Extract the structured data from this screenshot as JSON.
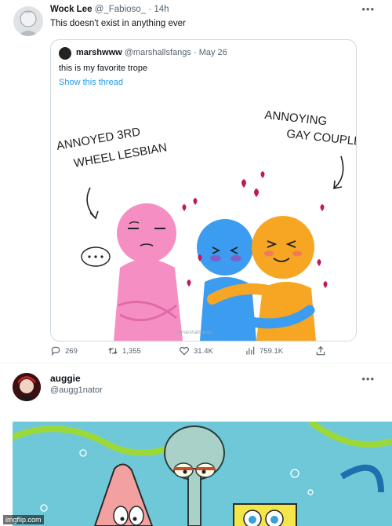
{
  "tweet1": {
    "author_name": "Wock Lee",
    "author_handle": "@_Fabioso_",
    "separator": "·",
    "time": "14h",
    "text": "This doesn't exist in anything ever",
    "more_icon": "more-dots-icon",
    "quote": {
      "author_name": "marshwww",
      "author_handle": "@marshallsfangs",
      "separator": "·",
      "date": "May 26",
      "text": "this is my favorite trope",
      "show_thread": "Show this thread",
      "comic": {
        "label_left": [
          "ANNOYED 3RD",
          "WHEEL LESBIAN"
        ],
        "label_right": [
          "ANNOYING",
          "GAY COUPLE"
        ],
        "signature": "@marshallsfangs"
      }
    },
    "actions": {
      "reply_count": "269",
      "retweet_count": "1,355",
      "like_count": "31.4K",
      "view_count": "759.1K"
    }
  },
  "tweet2": {
    "author_name": "auggie",
    "author_handle": "@augg1nator",
    "more_icon": "more-dots-icon"
  },
  "watermark": "imgflip.com",
  "colors": {
    "accent": "#1d9bf0",
    "muted": "#536471",
    "border": "#cfd9de",
    "pink": "#f58fc3",
    "blue": "#3b9cf0",
    "orange": "#f6a623",
    "heart": "#c2185b",
    "sea": "#6fc8d8"
  }
}
